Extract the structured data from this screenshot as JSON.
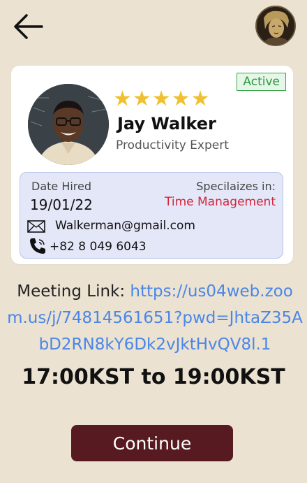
{
  "header": {
    "back_icon": "arrow-left-icon",
    "avatar_icon": "user-avatar"
  },
  "profile": {
    "status": "Active",
    "rating_stars": 5,
    "stars_text": "★★★★★",
    "name": "Jay Walker",
    "title": "Productivity Expert",
    "date_hired_label": "Date Hired",
    "date_hired": "19/01/22",
    "specializes_label": "Specilaizes in:",
    "specialization": "Time Management",
    "email": "Walkerman@gmail.com",
    "phone": "+82 8 049 6043"
  },
  "meeting": {
    "label": "Meeting Link: ",
    "url": "https://us04web.zoom.us/j/74814561651?pwd=JhtaZ35AbD2RN8kY6Dk2vJktHvQV8l.1",
    "time": "17:00KST to 19:00KST"
  },
  "actions": {
    "continue_label": "Continue"
  },
  "colors": {
    "background": "#ebe2d1",
    "status_green": "#2b9a3c",
    "star": "#f0c02f",
    "specialization": "#d4273b",
    "link": "#4a86e8",
    "button": "#571a21"
  }
}
